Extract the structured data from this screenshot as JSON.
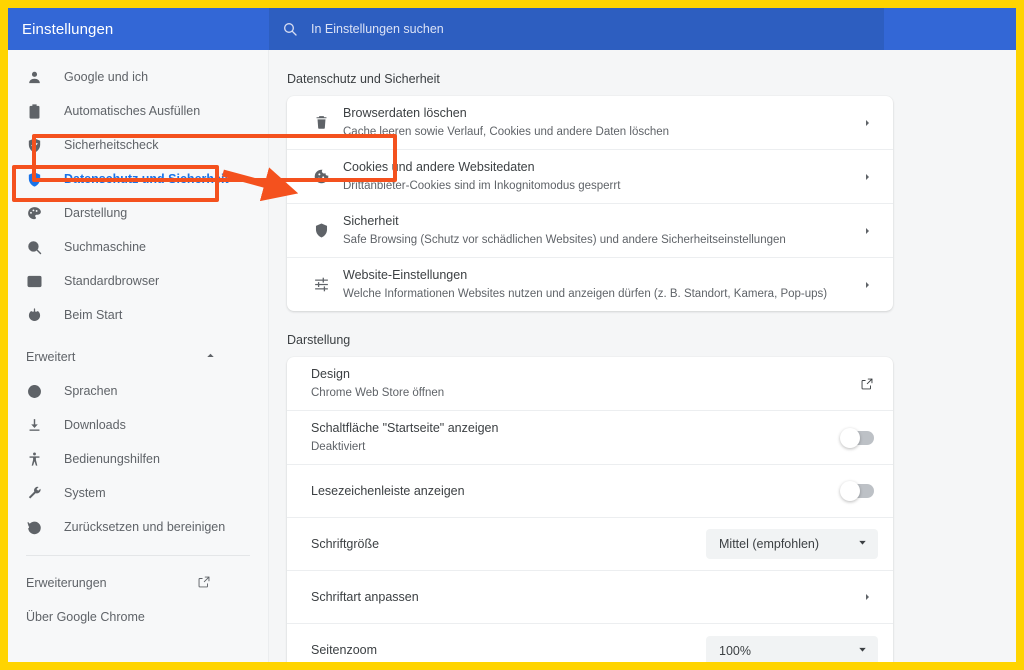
{
  "header": {
    "title": "Einstellungen",
    "search_placeholder": "In Einstellungen suchen",
    "search_value": "",
    "search_icon": "search-icon",
    "background_color": "#3367d6",
    "search_background_color": "#2d5ec0"
  },
  "sidebar": {
    "items": [
      {
        "label": "Google und ich",
        "icon": "person-icon",
        "selected": false
      },
      {
        "label": "Automatisches Ausfüllen",
        "icon": "clipboard-icon",
        "selected": false
      },
      {
        "label": "Sicherheitscheck",
        "icon": "shield-check-icon",
        "selected": false
      },
      {
        "label": "Datenschutz und Sicherheit",
        "icon": "shield-icon",
        "selected": true
      },
      {
        "label": "Darstellung",
        "icon": "palette-icon",
        "selected": false
      },
      {
        "label": "Suchmaschine",
        "icon": "search-icon",
        "selected": false
      },
      {
        "label": "Standardbrowser",
        "icon": "browser-window-icon",
        "selected": false
      },
      {
        "label": "Beim Start",
        "icon": "power-icon",
        "selected": false
      }
    ],
    "advanced": {
      "label": "Erweitert",
      "icon": "chevron-up-icon",
      "expanded": true
    },
    "advanced_items": [
      {
        "label": "Sprachen",
        "icon": "globe-icon"
      },
      {
        "label": "Downloads",
        "icon": "download-icon"
      },
      {
        "label": "Bedienungshilfen",
        "icon": "accessibility-icon"
      },
      {
        "label": "System",
        "icon": "wrench-icon"
      },
      {
        "label": "Zurücksetzen und bereinigen",
        "icon": "history-restore-icon"
      }
    ],
    "footer_items": [
      {
        "label": "Erweiterungen",
        "icon": "external-link-icon",
        "has_external_icon": true
      },
      {
        "label": "Über Google Chrome",
        "icon": "",
        "has_external_icon": false
      }
    ],
    "selected_color": "#1a73e8"
  },
  "main": {
    "privacy": {
      "section_title": "Datenschutz und Sicherheit",
      "rows": [
        {
          "title": "Browserdaten löschen",
          "subtitle": "Cache leeren sowie Verlauf, Cookies und andere Daten löschen",
          "icon": "trash-icon",
          "control": "chevron-right-icon"
        },
        {
          "title": "Cookies und andere Websitedaten",
          "subtitle": "Drittanbieter-Cookies sind im Inkognitomodus gesperrt",
          "icon": "cookie-icon",
          "control": "chevron-right-icon"
        },
        {
          "title": "Sicherheit",
          "subtitle": "Safe Browsing (Schutz vor schädlichen Websites) und andere Sicherheitseinstellungen",
          "icon": "shield-icon",
          "control": "chevron-right-icon"
        },
        {
          "title": "Website-Einstellungen",
          "subtitle": "Welche Informationen Websites nutzen und anzeigen dürfen (z. B. Standort, Kamera, Pop-ups)",
          "icon": "sliders-icon",
          "control": "chevron-right-icon"
        }
      ]
    },
    "appearance": {
      "section_title": "Darstellung",
      "rows": [
        {
          "title": "Design",
          "subtitle": "Chrome Web Store öffnen",
          "control": "external-link-icon"
        },
        {
          "title": "Schaltfläche \"Startseite\" anzeigen",
          "subtitle": "Deaktiviert",
          "control": "toggle",
          "toggle_on": false
        },
        {
          "title": "Lesezeichenleiste anzeigen",
          "subtitle": "",
          "control": "toggle",
          "toggle_on": false
        },
        {
          "title": "Schriftgröße",
          "subtitle": "",
          "control": "select",
          "select_value": "Mittel (empfohlen)"
        },
        {
          "title": "Schriftart anpassen",
          "subtitle": "",
          "control": "chevron-right-icon"
        },
        {
          "title": "Seitenzoom",
          "subtitle": "",
          "control": "select",
          "select_value": "100%"
        }
      ]
    }
  },
  "annotations": {
    "highlight_color": "#f4511e",
    "border_color": "#ffd400",
    "sidebar_highlight_target": "Datenschutz und Sicherheit",
    "content_highlight_target": "Cookies und andere Websitedaten",
    "arrow": "arrow-pointer"
  }
}
